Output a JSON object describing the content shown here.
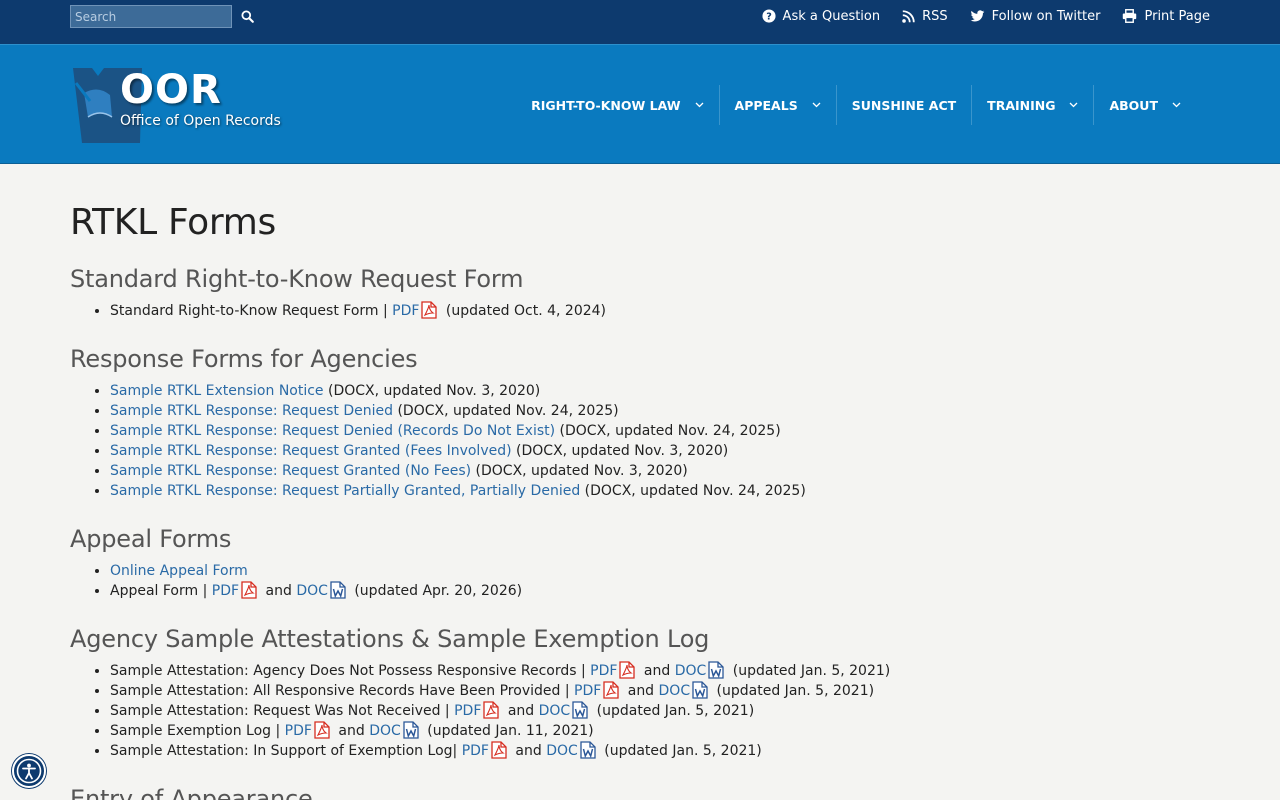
{
  "topbar": {
    "search_placeholder": "Search",
    "links": [
      {
        "label": "Ask a Question",
        "icon": "question-circle-icon"
      },
      {
        "label": "RSS",
        "icon": "rss-icon"
      },
      {
        "label": "Follow on Twitter",
        "icon": "twitter-icon"
      },
      {
        "label": "Print Page",
        "icon": "printer-icon"
      }
    ]
  },
  "header": {
    "logo_abbr": "OOR",
    "logo_name": "Office of Open Records",
    "nav": [
      {
        "label": "RIGHT-TO-KNOW LAW",
        "has_dropdown": true
      },
      {
        "label": "APPEALS",
        "has_dropdown": true
      },
      {
        "label": "SUNSHINE ACT",
        "has_dropdown": false
      },
      {
        "label": "TRAINING",
        "has_dropdown": true
      },
      {
        "label": "ABOUT",
        "has_dropdown": true
      }
    ]
  },
  "colors": {
    "topbar": "#0d3a6e",
    "header": "#0a7abf",
    "link": "#2a6aa6",
    "pdf_icon": "#d62d20",
    "doc_icon": "#2b5797"
  },
  "page": {
    "title": "RTKL Forms",
    "sections": [
      {
        "heading": "Standard Right-to-Know Request Form",
        "items": [
          {
            "text": "Standard Right-to-Know Request Form | ",
            "pdf": "PDF",
            "and": "",
            "doc": "",
            "suffix": " (updated Oct. 4, 2024)"
          }
        ]
      },
      {
        "heading": "Response Forms for Agencies",
        "items": [
          {
            "link": "Sample RTKL Extension Notice",
            "suffix": " (DOCX, updated Nov. 3, 2020)"
          },
          {
            "link": "Sample RTKL Response: Request Denied",
            "suffix": " (DOCX, updated Nov. 24, 2025)"
          },
          {
            "link": "Sample RTKL Response: Request Denied (Records Do Not Exist)",
            "suffix": " (DOCX, updated Nov. 24, 2025)"
          },
          {
            "link": "Sample RTKL Response: Request Granted (Fees Involved)",
            "suffix": " (DOCX, updated Nov. 3, 2020)"
          },
          {
            "link": "Sample RTKL Response: Request Granted (No Fees)",
            "suffix": " (DOCX, updated Nov. 3, 2020)"
          },
          {
            "link": "Sample RTKL Response: Request Partially Granted, Partially Denied",
            "suffix": " (DOCX, updated Nov. 24, 2025)"
          }
        ]
      },
      {
        "heading": "Appeal Forms",
        "items": [
          {
            "link": "Online Appeal Form",
            "suffix": ""
          },
          {
            "text": "Appeal Form | ",
            "pdf": "PDF",
            "and": "and",
            "doc": "DOC",
            "suffix": " (updated Apr. 20, 2026)"
          }
        ]
      },
      {
        "heading": "Agency Sample Attestations & Sample Exemption Log",
        "items": [
          {
            "text": "Sample Attestation: Agency Does Not Possess Responsive Records | ",
            "pdf": "PDF",
            "and": "and",
            "doc": "DOC",
            "suffix": " (updated Jan. 5, 2021)"
          },
          {
            "text": "Sample Attestation: All Responsive Records Have Been Provided | ",
            "pdf": "PDF",
            "and": "and",
            "doc": "DOC",
            "suffix": " (updated Jan. 5, 2021)"
          },
          {
            "text": "Sample Attestation: Request Was Not Received | ",
            "pdf": "PDF",
            "and": "and",
            "doc": "DOC",
            "suffix": " (updated Jan. 5, 2021)"
          },
          {
            "text": "Sample Exemption Log | ",
            "pdf": "PDF",
            "and": "and",
            "doc": "DOC",
            "suffix": " (updated Jan. 11, 2021)"
          },
          {
            "text": "Sample Attestation: In Support of Exemption Log| ",
            "pdf": "PDF",
            "and": "and",
            "doc": "DOC",
            "suffix": " (updated Jan. 5, 2021)"
          }
        ]
      },
      {
        "heading": "Entry of Appearance",
        "items": []
      }
    ]
  },
  "accessibility": {
    "icon": "accessibility-icon"
  }
}
